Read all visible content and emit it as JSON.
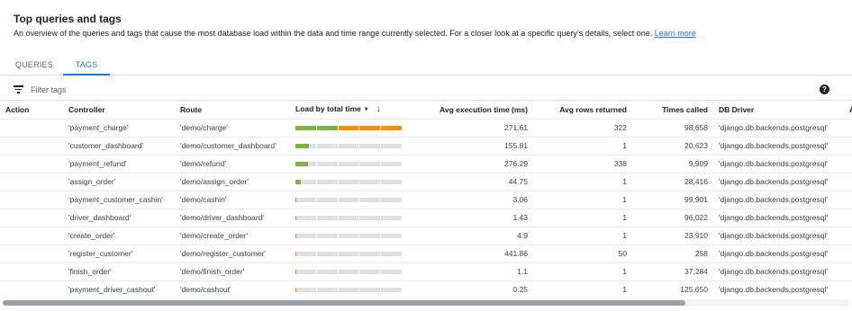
{
  "header": {
    "title": "Top queries and tags",
    "subtitle": "An overview of the queries and tags that cause the most database load within the data and time range currently selected. For a closer look at a specific query’s details, select one.",
    "learn_more": "Learn more"
  },
  "tabs": [
    {
      "label": "QUERIES",
      "active": false
    },
    {
      "label": "TAGS",
      "active": true
    }
  ],
  "filter": {
    "placeholder": "Filter tags",
    "icon": "filter-list-icon",
    "help_icon": "help-icon"
  },
  "table": {
    "columns": {
      "action": "Action",
      "controller": "Controller",
      "route": "Route",
      "load": "Load by total time",
      "exec_time": "Avg execution time (ms)",
      "rows": "Avg rows returned",
      "called": "Times called",
      "driver": "DB Driver",
      "extra": "Ap"
    },
    "sort_icons": {
      "dropdown": "▼",
      "direction": "↓"
    },
    "rows": [
      {
        "controller": "'payment_charge'",
        "route": "'demo/charge'",
        "load": 1.0,
        "exec_time": "271.61",
        "rows": "322",
        "called": "98,658",
        "driver": "'django.db.backends.postgresql'"
      },
      {
        "controller": "'customer_dashboard'",
        "route": "'demo/customer_dashboard'",
        "load": 0.13,
        "exec_time": "155.81",
        "rows": "1",
        "called": "20,623",
        "driver": "'django.db.backends.postgresql'"
      },
      {
        "controller": "'payment_refund'",
        "route": "'demo/refund'",
        "load": 0.12,
        "exec_time": "276.29",
        "rows": "338",
        "called": "9,909",
        "driver": "'django.db.backends.postgresql'"
      },
      {
        "controller": "'assign_order'",
        "route": "'demo/assign_order'",
        "load": 0.05,
        "exec_time": "44.75",
        "rows": "1",
        "called": "28,416",
        "driver": "'django.db.backends.postgresql'"
      },
      {
        "controller": "'payment_customer_cashin'",
        "route": "'demo/cashin'",
        "load": 0.012,
        "exec_time": "3.06",
        "rows": "1",
        "called": "99,901",
        "driver": "'django.db.backends.postgresql'"
      },
      {
        "controller": "'driver_dashboard'",
        "route": "'demo/driver_dashboard'",
        "load": 0.006,
        "exec_time": "1.43",
        "rows": "1",
        "called": "96,022",
        "driver": "'django.db.backends.postgresql'"
      },
      {
        "controller": "'create_order'",
        "route": "'demo/create_order'",
        "load": 0.004,
        "exec_time": "4.9",
        "rows": "1",
        "called": "23,910",
        "driver": "'django.db.backends.postgresql'"
      },
      {
        "controller": "'register_customer'",
        "route": "'demo/register_customer'",
        "load": 0.004,
        "exec_time": "441.86",
        "rows": "50",
        "called": "258",
        "driver": "'django.db.backends.postgresql'"
      },
      {
        "controller": "'finish_order'",
        "route": "'demo/finish_order'",
        "load": 0.002,
        "exec_time": "1.1",
        "rows": "1",
        "called": "37,284",
        "driver": "'django.db.backends.postgresql'"
      },
      {
        "controller": "'payment_driver_cashout'",
        "route": "'demo/cashout'",
        "load": 0.002,
        "exec_time": "0.25",
        "rows": "1",
        "called": "125,650",
        "driver": "'django.db.backends.postgresql'"
      }
    ]
  },
  "colors": {
    "accent": "#1a73e8",
    "load_green": "#7cb342",
    "load_orange": "#fb8c00",
    "load_empty": "#e0e0e0"
  },
  "scroll": {
    "horizontal_position": 0
  }
}
